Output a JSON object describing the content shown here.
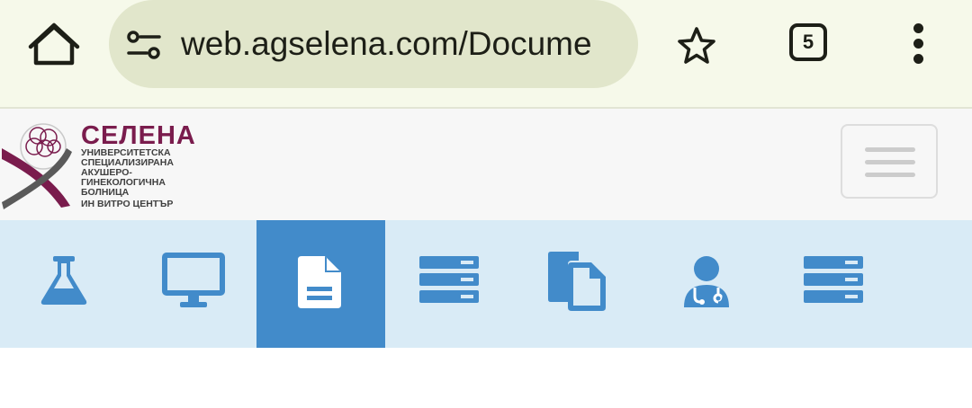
{
  "browser": {
    "url_display": "web.agselena.com/Docume",
    "tab_count": "5",
    "icons": {
      "home": "home-icon",
      "site_settings": "tune-icon",
      "bookmark": "star-icon",
      "tabs": "tab-switcher-icon",
      "menu": "more-vert-icon"
    }
  },
  "site": {
    "brand_name": "СЕЛЕНА",
    "brand_lines": [
      "УНИВЕРСИТЕТСКА",
      "СПЕЦИАЛИЗИРАНА",
      "АКУШЕРО-",
      "ГИНЕКОЛОГИЧНА",
      "БОЛНИЦА"
    ],
    "brand_sub": "ИН ВИТРО ЦЕНТЪР",
    "colors": {
      "brand": "#7a1c4d",
      "accent": "#428bca",
      "nav_bg": "#d9ebf6"
    }
  },
  "nav": {
    "active_index": 2,
    "items": [
      {
        "icon": "flask-icon"
      },
      {
        "icon": "monitor-icon"
      },
      {
        "icon": "document-icon"
      },
      {
        "icon": "server-list-icon"
      },
      {
        "icon": "copy-icon"
      },
      {
        "icon": "doctor-icon"
      },
      {
        "icon": "server-list-icon"
      }
    ]
  }
}
